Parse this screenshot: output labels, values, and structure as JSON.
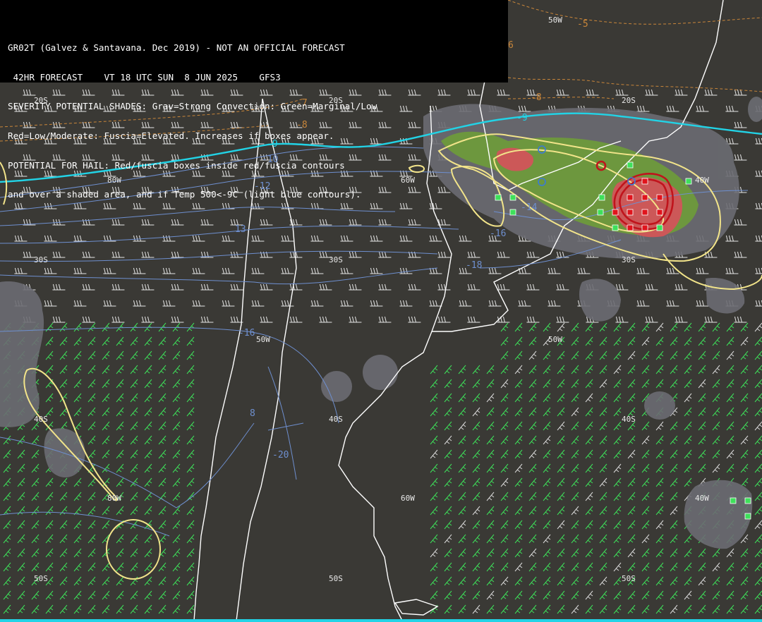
{
  "header": {
    "line1": "GR02T (Galvez & Santavana. Dec 2019) - NOT AN OFFICIAL FORECAST",
    "line2": " 42HR FORECAST    VT 18 UTC SUN  8 JUN 2025    GFS3",
    "line3": "SEVERITY POTENTIAL SHADES: Grav=Strong Convection: Green=Marginal/Low",
    "line4": "Red=Low/Moderate: Fuscia=Elevated. Increases if boxes appear.",
    "line5": "POTENTIAL FOR HAIL: Red/fuscia boxes inside red/fuscia contours",
    "line6": "and over a shaded area, and if Temp 500<-9C (light blue contours)."
  },
  "grid_labels": {
    "lat20": "20S",
    "lat30": "30S",
    "lat40": "40S",
    "lat50": "50S",
    "lon40": "40W",
    "lon50": "50W",
    "lon60": "60W",
    "lon80": "80W"
  },
  "contour_labels": {
    "t_minus5": "-5",
    "t_minus6": "6",
    "t_minus7": "-7",
    "t_minus8": "-8",
    "t_minus9": "-9",
    "t_minus10": "-10",
    "t_minus12": "-12",
    "t_minus13": "13",
    "t_minus14": "-14",
    "t_minus16": "-16",
    "t_minus18": "-18",
    "t_minus20": "-20",
    "t_8": "8"
  },
  "colors": {
    "background": "#3a3935",
    "coastline": "#ffffff",
    "gray_shade": "#6b6c72",
    "green_shade": "#6e9a3c",
    "red_shade": "#d2545a",
    "yellow_contour": "#f2e48a",
    "cyan_contour": "#22d3e6",
    "blue_contour": "#6e8fcf",
    "orange_contour": "#c9863a",
    "red_contour": "#c0141c",
    "green_barbs": "#3ee05a",
    "white_barbs": "#e6e6e6"
  }
}
